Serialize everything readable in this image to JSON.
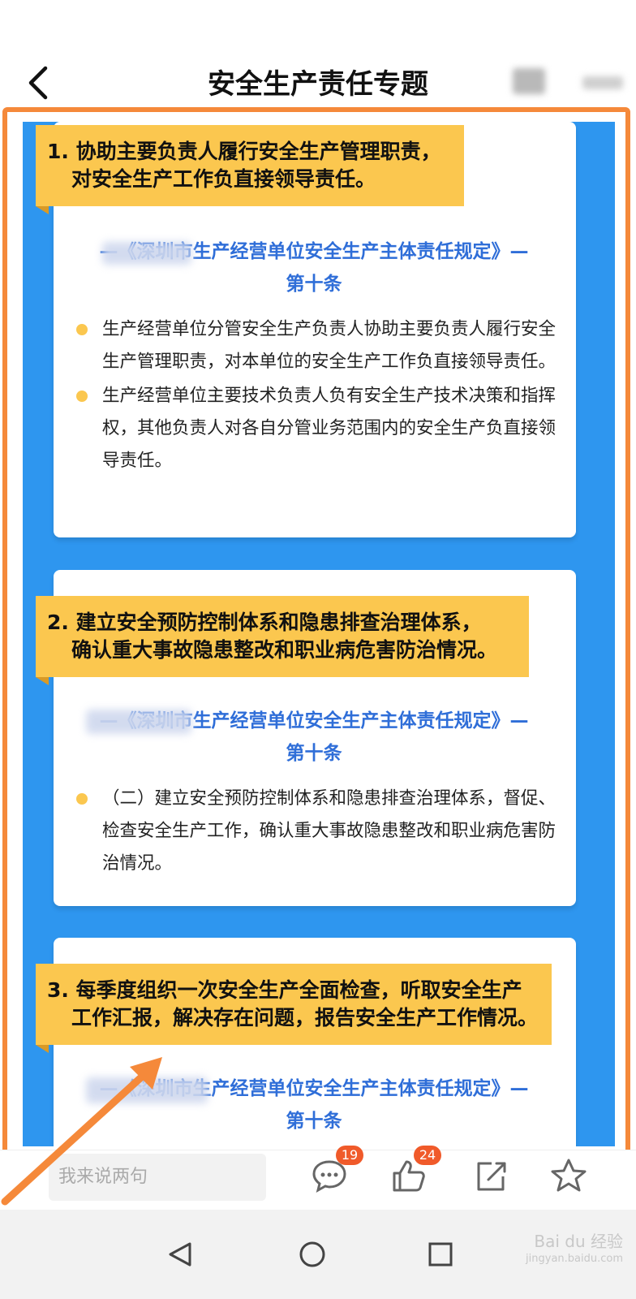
{
  "header": {
    "title": "安全生产责任专题"
  },
  "cards": [
    {
      "banner_line1": "1. 协助主要负责人履行安全生产管理职责，",
      "banner_line2": "对安全生产工作负直接领导责任。",
      "ref_line1": "—《深圳市生产经营单位安全生产主体责任规定》—",
      "ref_line2": "第十条",
      "bullets": [
        "生产经营单位分管安全生产负责人协助主要负责人履行安全生产管理职责，对本单位的安全生产工作负直接领导责任。",
        "生产经营单位主要技术负责人负有安全生产技术决策和指挥权，其他负责人对各自分管业务范围内的安全生产负直接领导责任。"
      ]
    },
    {
      "banner_line1": "2. 建立安全预防控制体系和隐患排查治理体系，",
      "banner_line2": "确认重大事故隐患整改和职业病危害防治情况。",
      "ref_line1": "—《深圳市生产经营单位安全生产主体责任规定》—",
      "ref_line2": "第十条",
      "bullets": [
        "（二）建立安全预防控制体系和隐患排查治理体系，督促、检查安全生产工作，确认重大事故隐患整改和职业病危害防治情况。"
      ]
    },
    {
      "banner_line1": "3. 每季度组织一次安全生产全面检查，听取安全生产",
      "banner_line2": "工作汇报，解决存在问题，报告安全生产工作情况。",
      "ref_line1": "—《深圳市生产经营单位安全生产主体责任规定》—",
      "ref_line2": "第十条",
      "bullets": []
    }
  ],
  "bottom_bar": {
    "comment_placeholder": "我来说两句",
    "comment_count": "19",
    "like_count": "24",
    "icons": [
      "comment-icon",
      "thumbs-up-icon",
      "share-icon",
      "star-icon"
    ]
  },
  "watermark": {
    "brand": "Bai du 经验",
    "url": "jingyan.baidu.com"
  },
  "colors": {
    "accent_blue": "#2e96ef",
    "banner_yellow": "#fbc74f",
    "highlight_orange": "#f5893a",
    "ref_blue": "#2f6ed8",
    "badge_red": "#f05a2a"
  }
}
